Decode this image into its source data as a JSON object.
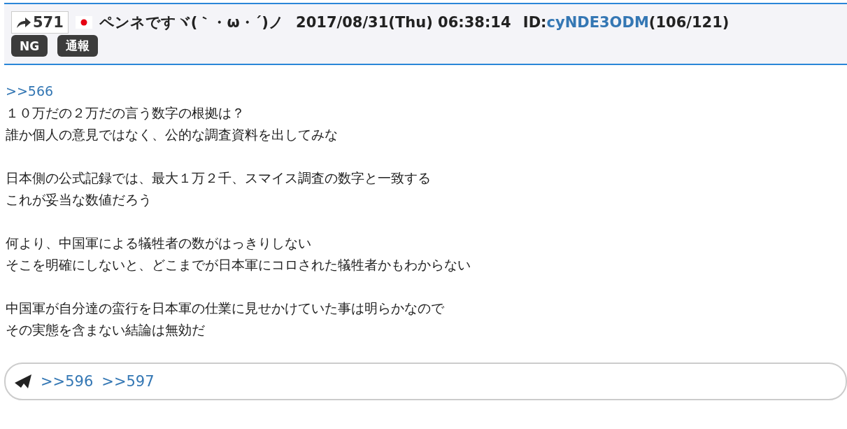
{
  "post": {
    "number": "571",
    "has_flag": true,
    "name": "ペンネですヾ(｀・ω・´)ノ",
    "datetime": "2017/08/31(Thu) 06:38:14",
    "id_label": "ID:",
    "id": "cyNDE3ODM",
    "count": "(106/121)"
  },
  "actions": [
    "NG",
    "通報"
  ],
  "reply_to": ">>566",
  "paragraphs": [
    [
      "１０万だの２万だの言う数字の根拠は？",
      "誰か個人の意見ではなく、公的な調査資料を出してみな"
    ],
    [
      "日本側の公式記録では、最大１万２千、スマイス調査の数字と一致する",
      "これが妥当な数値だろう"
    ],
    [
      "何より、中国軍による犠牲者の数がはっきりしない",
      "そこを明確にしないと、どこまでが日本軍にコロされた犠牲者かもわからない"
    ],
    [
      "中国軍が自分達の蛮行を日本軍の仕業に見せかけていた事は明らかなので",
      "その実態を含まない結論は無効だ"
    ]
  ],
  "replies": [
    ">>596",
    ">>597"
  ]
}
